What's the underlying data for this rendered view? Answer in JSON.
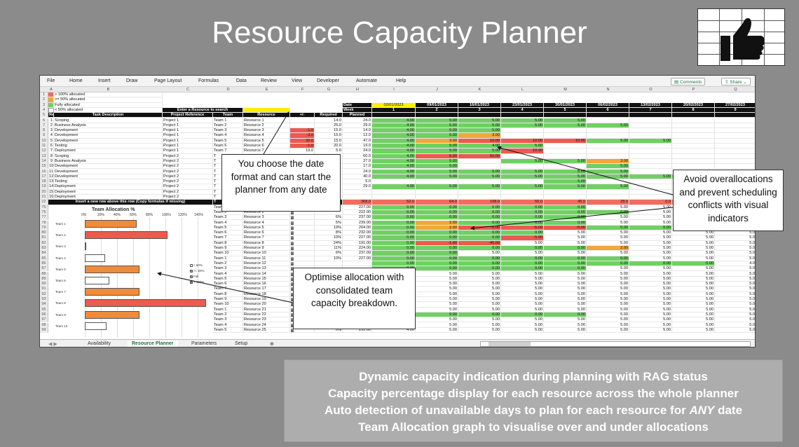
{
  "title": "Resource Capacity Planner",
  "logo_icon": "thumbs-up-icon",
  "menu": [
    "File",
    "Home",
    "Insert",
    "Draw",
    "Page Layout",
    "Formulas",
    "Data",
    "Review",
    "View",
    "Developer",
    "Automate",
    "Help"
  ],
  "comments_label": "Comments",
  "share_label": "Share",
  "columns": [
    "A",
    "B",
    "C",
    "D",
    "E",
    "F",
    "G",
    "H",
    "I",
    "J",
    "K",
    "L",
    "M",
    "N",
    "O",
    "P",
    "Q"
  ],
  "legend": [
    "> 100% allocated",
    ">= 50% allocated",
    "Fully allocated",
    "< 50% allocated"
  ],
  "search_label": "Enter a Resource to search",
  "date_label": "Date",
  "week_label": "Week",
  "dates": [
    "02/01/2023",
    "09/01/2023",
    "16/01/2023",
    "23/01/2023",
    "30/01/2023",
    "06/02/2023",
    "13/02/2023",
    "20/02/2023",
    "27/02/2023"
  ],
  "weeks": [
    "1",
    "2",
    "3",
    "4",
    "5",
    "6",
    "7",
    "8",
    "9"
  ],
  "header_cols": [
    "Ref",
    "Task Description",
    "Project Reference",
    "Team",
    "Resource",
    "+/-",
    "Required",
    "Planned"
  ],
  "tasks": [
    [
      "1",
      "Scoping",
      "Project 1",
      "Team 1",
      "Resource 1",
      "",
      "14.0",
      "24.0"
    ],
    [
      "2",
      "Business Analysis",
      "Project 1",
      "Team 2",
      "Resource 2",
      "",
      "25.0",
      "29.0"
    ],
    [
      "3",
      "Development",
      "Project 1",
      "Team 3",
      "Resource 3",
      "-1.0",
      "15.0",
      "14.0"
    ],
    [
      "4",
      "Development",
      "Project 1",
      "Team 4",
      "Resource 4",
      "-3.0",
      "15.0",
      "12.0"
    ],
    [
      "5",
      "Development",
      "Project 1",
      "Team 5",
      "Resource 5",
      "32.0",
      "15.0",
      "47.0"
    ],
    [
      "6",
      "Testing",
      "Project 1",
      "Team 6",
      "Resource 6",
      "-1.0",
      "20.0",
      "19.0"
    ],
    [
      "7",
      "Deployment",
      "Project 1",
      "Team 7",
      "Resource 7",
      "19.0",
      "5.0",
      "24.0"
    ],
    [
      "8",
      "Scoping",
      "Project 2",
      "T",
      "",
      "",
      "",
      "60.0"
    ],
    [
      "9",
      "Business Analysis",
      "Project 2",
      "T",
      "",
      "",
      "",
      "27.0"
    ],
    [
      "10",
      "Development",
      "Project 2",
      "T",
      "",
      "",
      "",
      "17.0"
    ],
    [
      "11",
      "Development",
      "Project 2",
      "T",
      "",
      "",
      "",
      "24.0"
    ],
    [
      "12",
      "Development",
      "Project 2",
      "T",
      "",
      "",
      "",
      "40.0"
    ],
    [
      "13",
      "Testing",
      "Project 2",
      "T",
      "",
      "",
      "",
      "5.0"
    ],
    [
      "14",
      "Deployment",
      "Project 2",
      "T",
      "",
      "",
      "",
      "29.0"
    ],
    [
      "15",
      "Deployment",
      "Project 2",
      "T",
      "",
      "",
      "",
      ""
    ],
    [
      "16",
      "Deployment",
      "Project 2",
      "T",
      "",
      "",
      "",
      ""
    ]
  ],
  "insert_row_note": "Insert a new row above this row (Copy formulas if missing)",
  "total_planned": "368.0",
  "totals": [
    "52.0",
    "64.0",
    "108.0",
    "55.0",
    "45.0",
    "28.0",
    "0.0"
  ],
  "chart_title": "Team Allocation %",
  "chart_axis": [
    "0%",
    "20%",
    "40%",
    "60%",
    "80%",
    "100%",
    "120%",
    "140%"
  ],
  "team_labels": [
    "Team 1",
    "Team 2",
    "Team 3",
    "Team 4",
    "Team 5",
    "Team 6",
    "Team 7",
    "Team 8",
    "Team 9",
    "Team 10"
  ],
  "team_alloc": [
    64,
    103,
    0,
    25,
    68,
    30,
    68,
    150,
    68,
    27
  ],
  "chart_legend": [
    "< 50%",
    ">= 50%",
    "Full",
    "> 100%"
  ],
  "resources": [
    [
      "Team 1",
      "Resource 1",
      "",
      "227.00"
    ],
    [
      "Team 2",
      "Resource 2",
      "",
      "222.00"
    ],
    [
      "Team 3",
      "Resource 3",
      "6%",
      "237.00"
    ],
    [
      "Team 4",
      "Resource 4",
      "5%",
      "239.00"
    ],
    [
      "Team 5",
      "Resource 5",
      "19%",
      "204.00"
    ],
    [
      "Team 6",
      "Resource 6",
      "8%",
      "232.00"
    ],
    [
      "Team 7",
      "Resource 7",
      "10%",
      "227.00"
    ],
    [
      "Team 8",
      "Resource 8",
      "24%",
      "191.00"
    ],
    [
      "Team 9",
      "Resource 9",
      "11%",
      "224.00"
    ],
    [
      "Team 10",
      "Resource 10",
      "6%",
      "237.00"
    ],
    [
      "Team 1",
      "Resource 11",
      "10%",
      "227.00"
    ],
    [
      "Team 2",
      "Resource 12",
      "",
      ""
    ],
    [
      "Team 3",
      "Resource 13",
      "",
      ""
    ],
    [
      "Team 4",
      "Resource 14",
      "",
      ""
    ],
    [
      "Team 5",
      "Resource 15",
      "",
      ""
    ],
    [
      "Team 6",
      "Resource 16",
      "",
      ""
    ],
    [
      "Team 7",
      "Resource 17",
      "",
      ""
    ],
    [
      "Team 8",
      "Resource 18",
      "",
      ""
    ],
    [
      "Team 9",
      "Resource 19",
      "",
      ""
    ],
    [
      "Team 10",
      "Resource 20",
      "",
      ""
    ],
    [
      "Team 1",
      "Resource 21",
      "",
      ""
    ],
    [
      "Team 2",
      "Resource 22",
      "",
      ""
    ],
    [
      "Team 3",
      "Resource 23",
      "",
      ""
    ],
    [
      "Team 4",
      "Resource 24",
      "0%",
      "251.00"
    ],
    [
      "Team 5",
      "Resource 25",
      "0%",
      "251.00"
    ]
  ],
  "sheet_tabs": [
    "Availability",
    "Resource Planner",
    "Parameters",
    "Setup"
  ],
  "callouts": {
    "date": "You choose the date format and can start the planner from any date",
    "over": "Avoid overallocations and prevent scheduling conflicts with visual indicators",
    "team": "Optimise allocation with consolidated team capacity breakdown."
  },
  "bottom_lines": [
    "Dynamic capacity indication during planning with RAG status",
    "Capacity percentage display for each resource across the whole planner",
    "Auto detection of unavailable days to plan for each resource for ",
    "Team Allocation graph to visualise over and under allocations"
  ],
  "bottom_emph": "ANY",
  "bottom_tail": " date"
}
